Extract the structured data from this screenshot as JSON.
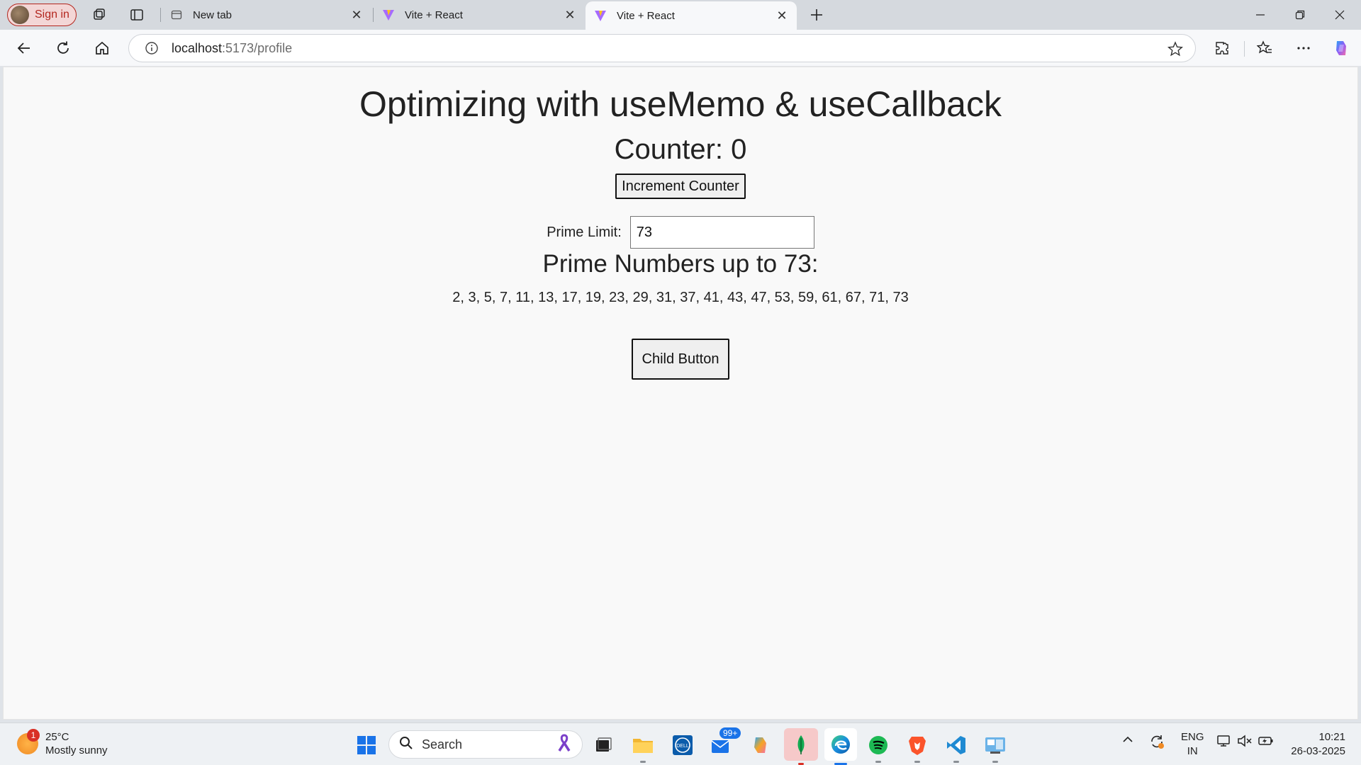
{
  "browser": {
    "profile_label": "Sign in",
    "tabs": [
      {
        "title": "New tab",
        "favicon": "newtab-icon"
      },
      {
        "title": "Vite + React",
        "favicon": "vite-icon"
      },
      {
        "title": "Vite + React",
        "favicon": "vite-icon",
        "active": true
      }
    ],
    "url_host": "localhost",
    "url_path": ":5173/profile"
  },
  "page": {
    "title": "Optimizing with useMemo & useCallback",
    "counter_text": "Counter: 0",
    "increment_label": "Increment Counter",
    "prime_limit_label": "Prime Limit:",
    "prime_limit_value": "73",
    "primes_heading": "Prime Numbers up to 73:",
    "primes_list": "2, 3, 5, 7, 11, 13, 17, 19, 23, 29, 31, 37, 41, 43, 47, 53, 59, 61, 67, 71, 73",
    "child_button_label": "Child Button"
  },
  "taskbar": {
    "weather_temp": "25°C",
    "weather_desc": "Mostly sunny",
    "weather_badge": "1",
    "search_placeholder": "Search",
    "mail_badge": "99+",
    "lang_line1": "ENG",
    "lang_line2": "IN",
    "time": "10:21",
    "date": "26-03-2025"
  },
  "colors": {
    "accent": "#1a73e8",
    "profile_red": "#b3261e",
    "page_bg": "#f9f9f9"
  }
}
